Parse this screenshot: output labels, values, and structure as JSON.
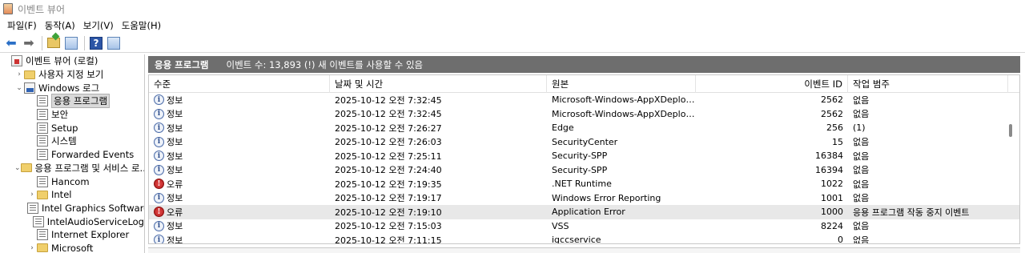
{
  "window": {
    "title": "이벤트 뷰어"
  },
  "menu": [
    "파일(F)",
    "동작(A)",
    "보기(V)",
    "도움말(H)"
  ],
  "toolbar": {
    "buttons": [
      "back-arrow-icon",
      "forward-arrow-icon",
      "up-folder-icon",
      "show-hide-tree-icon",
      "help-icon",
      "show-hide-action-pane-icon"
    ]
  },
  "tree": {
    "items": [
      {
        "label": "이벤트 뷰어 (로컬)",
        "level": 0,
        "chev": "",
        "icon": "viewer"
      },
      {
        "label": "사용자 지정 보기",
        "level": 1,
        "chev": "›",
        "icon": "folder"
      },
      {
        "label": "Windows 로그",
        "level": 1,
        "chev": "⌄",
        "icon": "winlog"
      },
      {
        "label": "응용 프로그램",
        "level": 2,
        "chev": "",
        "icon": "log",
        "selected": true
      },
      {
        "label": "보안",
        "level": 2,
        "chev": "",
        "icon": "log"
      },
      {
        "label": "Setup",
        "level": 2,
        "chev": "",
        "icon": "log"
      },
      {
        "label": "시스템",
        "level": 2,
        "chev": "",
        "icon": "log"
      },
      {
        "label": "Forwarded Events",
        "level": 2,
        "chev": "",
        "icon": "log"
      },
      {
        "label": "응용 프로그램 및 서비스 로...",
        "level": 1,
        "chev": "⌄",
        "icon": "folder"
      },
      {
        "label": "Hancom",
        "level": 2,
        "chev": "",
        "icon": "log"
      },
      {
        "label": "Intel",
        "level": 2,
        "chev": "›",
        "icon": "folder"
      },
      {
        "label": "Intel Graphics Software",
        "level": 2,
        "chev": "",
        "icon": "log"
      },
      {
        "label": "IntelAudioServiceLog",
        "level": 2,
        "chev": "",
        "icon": "log"
      },
      {
        "label": "Internet Explorer",
        "level": 2,
        "chev": "",
        "icon": "log"
      },
      {
        "label": "Microsoft",
        "level": 2,
        "chev": "›",
        "icon": "folder"
      }
    ]
  },
  "header": {
    "name": "응용 프로그램",
    "summary": "이벤트 수: 13,893 (!) 새 이벤트를 사용할 수 있음"
  },
  "table": {
    "columns": [
      "수준",
      "날짜 및 시간",
      "원본",
      "이벤트 ID",
      "작업 범주"
    ],
    "rows": [
      {
        "level": "정보",
        "type": "info",
        "date": "2025-10-12 오전 7:32:45",
        "source": "Microsoft-Windows-AppXDeploym...",
        "id": "2562",
        "cat": "없음"
      },
      {
        "level": "정보",
        "type": "info",
        "date": "2025-10-12 오전 7:32:45",
        "source": "Microsoft-Windows-AppXDeploym...",
        "id": "2562",
        "cat": "없음"
      },
      {
        "level": "정보",
        "type": "info",
        "date": "2025-10-12 오전 7:26:27",
        "source": "Edge",
        "id": "256",
        "cat": "(1)"
      },
      {
        "level": "정보",
        "type": "info",
        "date": "2025-10-12 오전 7:26:03",
        "source": "SecurityCenter",
        "id": "15",
        "cat": "없음"
      },
      {
        "level": "정보",
        "type": "info",
        "date": "2025-10-12 오전 7:25:11",
        "source": "Security-SPP",
        "id": "16384",
        "cat": "없음"
      },
      {
        "level": "정보",
        "type": "info",
        "date": "2025-10-12 오전 7:24:40",
        "source": "Security-SPP",
        "id": "16394",
        "cat": "없음"
      },
      {
        "level": "오류",
        "type": "error",
        "date": "2025-10-12 오전 7:19:35",
        "source": ".NET Runtime",
        "id": "1022",
        "cat": "없음"
      },
      {
        "level": "정보",
        "type": "info",
        "date": "2025-10-12 오전 7:19:17",
        "source": "Windows Error Reporting",
        "id": "1001",
        "cat": "없음"
      },
      {
        "level": "오류",
        "type": "error",
        "date": "2025-10-12 오전 7:19:10",
        "source": "Application Error",
        "id": "1000",
        "cat": "응용 프로그램 작동 중지 이벤트",
        "highlight": true
      },
      {
        "level": "정보",
        "type": "info",
        "date": "2025-10-12 오전 7:15:03",
        "source": "VSS",
        "id": "8224",
        "cat": "없음"
      },
      {
        "level": "정보",
        "type": "info",
        "date": "2025-10-12 오전 7:11:15",
        "source": "igccservice",
        "id": "0",
        "cat": "없음"
      }
    ]
  },
  "colors": {
    "header_bar": "#6e6e6e",
    "selected_row": "#e8e8e8",
    "error": "#b01818",
    "info": "#2a4a8a"
  }
}
